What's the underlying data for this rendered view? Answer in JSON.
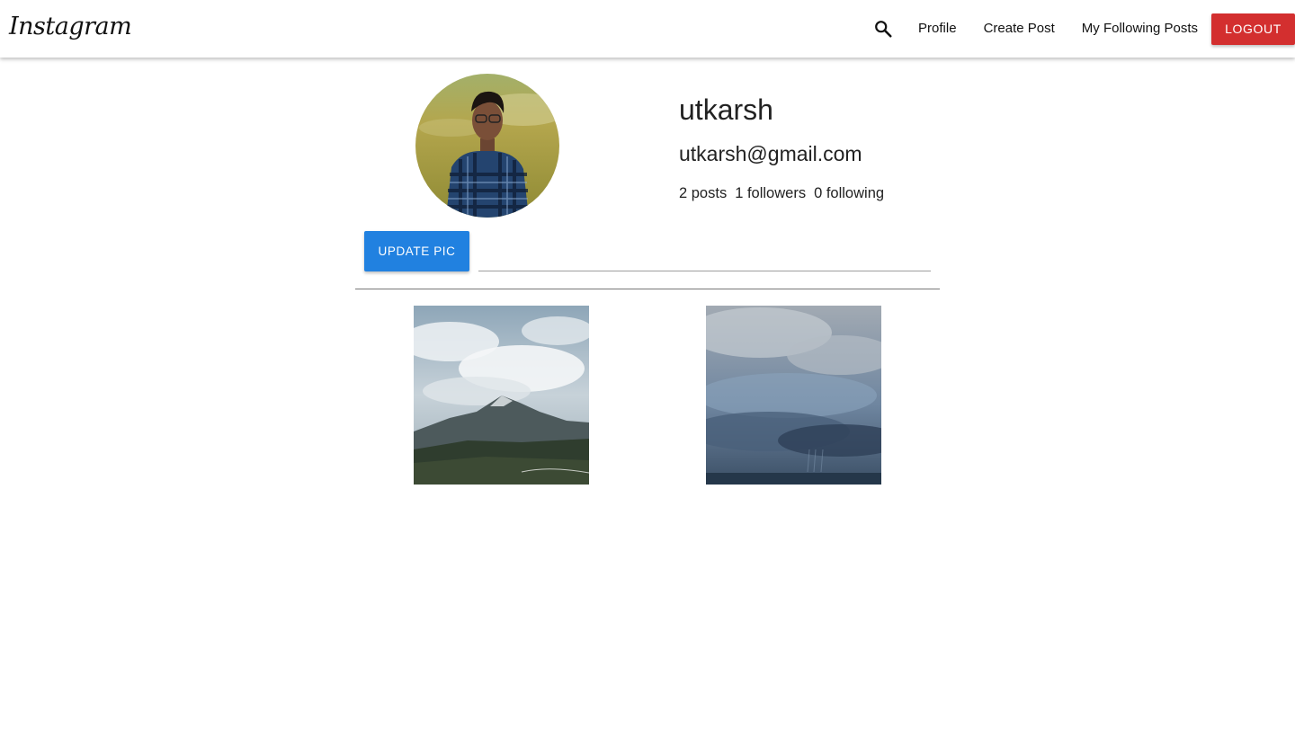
{
  "navbar": {
    "brand": "Instagram",
    "links": {
      "profile": "Profile",
      "create_post": "Create Post",
      "following_posts": "My Following Posts"
    },
    "logout_label": "LOGOUT",
    "icons": {
      "search": "search-icon"
    },
    "colors": {
      "logout": "#d32f2f"
    }
  },
  "profile": {
    "name": "utkarsh",
    "email": "utkarsh@gmail.com",
    "stats": {
      "posts": "2 posts",
      "followers": "1 followers",
      "following": "0 following"
    },
    "update_pic_label": "UPDATE PIC",
    "file_path_value": "",
    "colors": {
      "update_button": "#2181e0"
    }
  },
  "gallery": {
    "items": [
      "mountain-clouds-photo",
      "stormy-sky-photo"
    ]
  }
}
